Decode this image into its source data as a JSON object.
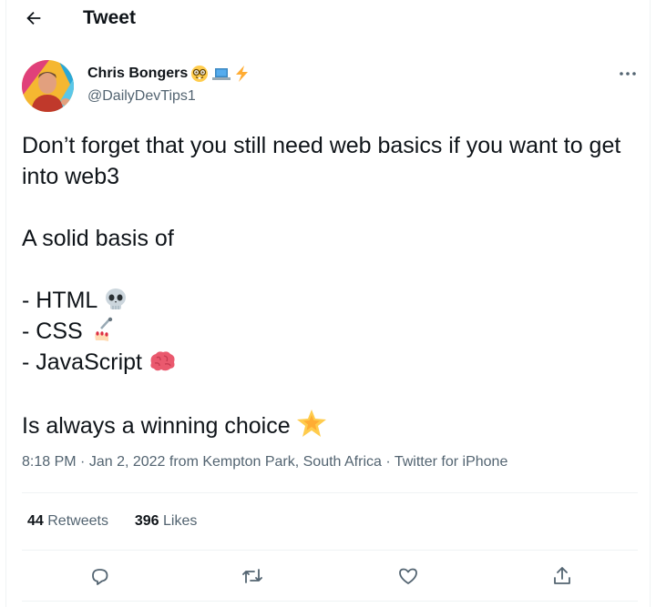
{
  "header": {
    "title": "Tweet",
    "back_icon": "arrow-left-icon"
  },
  "author": {
    "name": "Chris Bongers",
    "handle": "@DailyDevTips1",
    "name_emojis": [
      "nerd-face-icon",
      "laptop-icon",
      "lightning-icon"
    ]
  },
  "tweet": {
    "line1": "Don’t forget that you still need web basics if you want to get into web3",
    "line2": "A solid basis of",
    "list": [
      {
        "text": "- HTML",
        "emoji": "skull-icon"
      },
      {
        "text": "- CSS",
        "emoji": "nail-polish-icon"
      },
      {
        "text": "- JavaScript",
        "emoji": "brain-icon"
      }
    ],
    "closing": "Is always a winning choice",
    "closing_emoji": "glowing-star-icon"
  },
  "meta": {
    "time": "8:18 PM",
    "date": "Jan 2, 2022",
    "from": "from",
    "location": "Kempton Park, South Africa",
    "client": "Twitter for iPhone",
    "dot": "·"
  },
  "stats": {
    "retweets_count": "44",
    "retweets_label": "Retweets",
    "likes_count": "396",
    "likes_label": "Likes"
  },
  "actions": [
    "reply-icon",
    "retweet-icon",
    "like-icon",
    "share-icon"
  ],
  "colors": {
    "text": "#0f1419",
    "secondary": "#536471",
    "divider": "#eff3f4"
  }
}
